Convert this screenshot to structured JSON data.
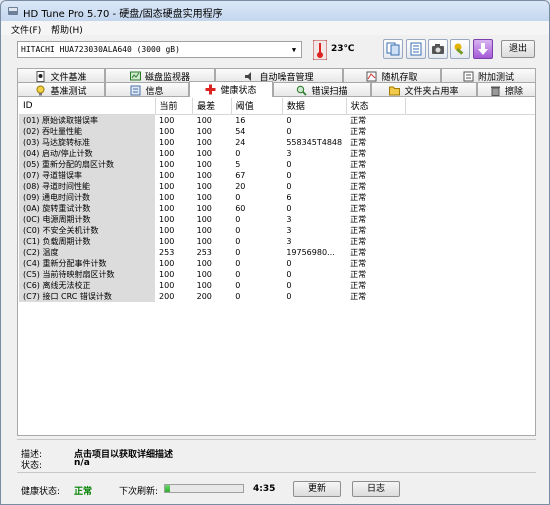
{
  "window": {
    "title": "HD Tune Pro 5.70 - 硬盘/固态硬盘实用程序"
  },
  "menu": {
    "file": "文件(F)",
    "help": "帮助(H)"
  },
  "toolbar": {
    "drive": "HITACHI HUA723030ALA640  (3000 gB)",
    "temperature": "23℃",
    "exit": "退出"
  },
  "tabs_row1": [
    "文件基准",
    "磁盘监视器",
    "自动噪音管理",
    "随机存取",
    "附加测试"
  ],
  "tabs_row2": [
    "基准测试",
    "信息",
    "健康状态",
    "错误扫描",
    "文件夹占用率",
    "擦除"
  ],
  "table": {
    "headers": [
      "ID",
      "当前",
      "最差",
      "阈值",
      "数据",
      "状态"
    ],
    "rows": [
      [
        "(01) 原始读取错误率",
        "100",
        "100",
        "16",
        "0",
        "正常"
      ],
      [
        "(02) 吞吐量性能",
        "100",
        "100",
        "54",
        "0",
        "正常"
      ],
      [
        "(03) 马达旋转标准",
        "100",
        "100",
        "24",
        "558345T4848",
        "正常"
      ],
      [
        "(04) 启动/停止计数",
        "100",
        "100",
        "0",
        "3",
        "正常"
      ],
      [
        "(05) 重新分配的扇区计数",
        "100",
        "100",
        "5",
        "0",
        "正常"
      ],
      [
        "(07) 寻道错误率",
        "100",
        "100",
        "67",
        "0",
        "正常"
      ],
      [
        "(08) 寻道时间性能",
        "100",
        "100",
        "20",
        "0",
        "正常"
      ],
      [
        "(09) 通电时间计数",
        "100",
        "100",
        "0",
        "6",
        "正常"
      ],
      [
        "(0A) 旋转重试计数",
        "100",
        "100",
        "60",
        "0",
        "正常"
      ],
      [
        "(0C) 电源周期计数",
        "100",
        "100",
        "0",
        "3",
        "正常"
      ],
      [
        "(C0) 不安全关机计数",
        "100",
        "100",
        "0",
        "3",
        "正常"
      ],
      [
        "(C1) 负载周期计数",
        "100",
        "100",
        "0",
        "3",
        "正常"
      ],
      [
        "(C2) 温度",
        "253",
        "253",
        "0",
        "19756980...",
        "正常"
      ],
      [
        "(C4) 重新分配事件计数",
        "100",
        "100",
        "0",
        "0",
        "正常"
      ],
      [
        "(C5) 当前待映射扇区计数",
        "100",
        "100",
        "0",
        "0",
        "正常"
      ],
      [
        "(C6) 离线无法校正",
        "100",
        "100",
        "0",
        "0",
        "正常"
      ],
      [
        "(C7) 接口 CRC 错误计数",
        "200",
        "200",
        "0",
        "0",
        "正常"
      ]
    ]
  },
  "details": {
    "desc_label": "描述:",
    "desc_value": "点击项目以获取详细描述",
    "status_label": "状态:",
    "status_value": "n/a"
  },
  "footer": {
    "health_label": "健康状态:",
    "health_value": "正常",
    "refresh_label": "下次刷新:",
    "refresh_progress": 0.06,
    "refresh_time": "4:35",
    "update": "更新",
    "log": "日志"
  },
  "colors": {
    "ok": "#008000",
    "progress": "#2fae2f"
  }
}
